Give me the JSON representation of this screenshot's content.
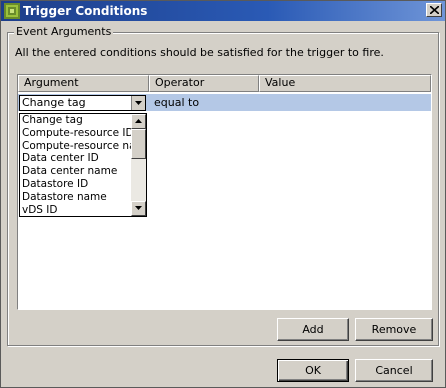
{
  "window": {
    "title": "Trigger Conditions",
    "icon": "vmware-app-icon",
    "close_icon": "close-icon"
  },
  "group": {
    "legend": "Event Arguments",
    "description": "All the entered conditions should be satisfied for the trigger to fire."
  },
  "grid": {
    "columns": [
      "Argument",
      "Operator",
      "Value"
    ],
    "row": {
      "argument": "Change tag",
      "operator": "equal to",
      "value": ""
    },
    "selected_row_color": "#b4c8e6"
  },
  "dropdown": {
    "items": [
      "Change tag",
      "Compute-resource ID f",
      "Compute-resource nan",
      "Data center ID",
      "Data center name",
      "Datastore ID",
      "Datastore name",
      "vDS ID"
    ]
  },
  "buttons": {
    "add": "Add",
    "remove": "Remove",
    "ok": "OK",
    "cancel": "Cancel"
  },
  "colors": {
    "titlebar_start": "#1d3e8a",
    "titlebar_end": "#6f95d8",
    "dialog_face": "#d4d0c8"
  }
}
